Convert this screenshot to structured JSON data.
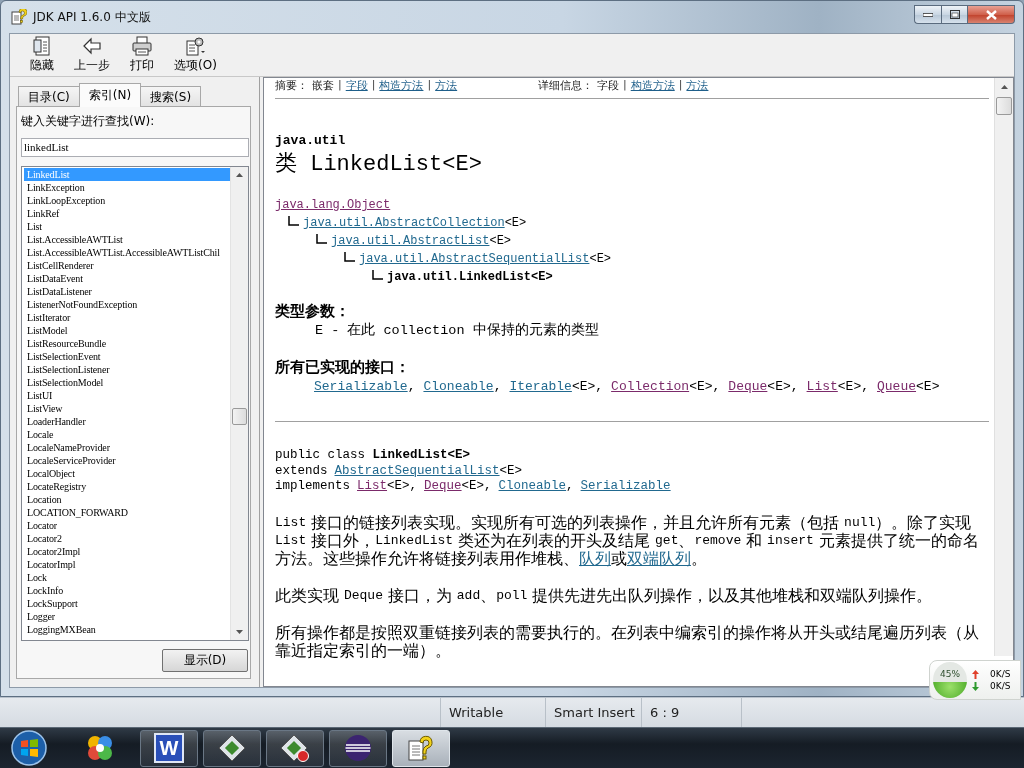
{
  "window": {
    "title": "JDK API 1.6.0 中文版"
  },
  "toolbar": [
    {
      "kind": "hide",
      "label": "隐藏"
    },
    {
      "kind": "back",
      "label": "上一步"
    },
    {
      "kind": "print",
      "label": "打印"
    },
    {
      "kind": "options",
      "label": "选项(O)"
    }
  ],
  "nav_panel": {
    "tabs": [
      {
        "label": "目录(C)",
        "selected": false
      },
      {
        "label": "索引(N)",
        "selected": true
      },
      {
        "label": "搜索(S)",
        "selected": false
      }
    ],
    "search_label": "键入关键字进行查找(W):",
    "search": {
      "value": "linkedList"
    },
    "results": [
      {
        "label": "LinkedList",
        "selected": true
      },
      {
        "label": "LinkException",
        "selected": false
      },
      {
        "label": "LinkLoopException",
        "selected": false
      },
      {
        "label": "LinkRef",
        "selected": false
      },
      {
        "label": "List",
        "selected": false
      },
      {
        "label": "List.AccessibleAWTList",
        "selected": false
      },
      {
        "label": "List.AccessibleAWTList.AccessibleAWTListChil",
        "selected": false
      },
      {
        "label": "ListCellRenderer",
        "selected": false
      },
      {
        "label": "ListDataEvent",
        "selected": false
      },
      {
        "label": "ListDataListener",
        "selected": false
      },
      {
        "label": "ListenerNotFoundException",
        "selected": false
      },
      {
        "label": "ListIterator",
        "selected": false
      },
      {
        "label": "ListModel",
        "selected": false
      },
      {
        "label": "ListResourceBundle",
        "selected": false
      },
      {
        "label": "ListSelectionEvent",
        "selected": false
      },
      {
        "label": "ListSelectionListener",
        "selected": false
      },
      {
        "label": "ListSelectionModel",
        "selected": false
      },
      {
        "label": "ListUI",
        "selected": false
      },
      {
        "label": "ListView",
        "selected": false
      },
      {
        "label": "LoaderHandler",
        "selected": false
      },
      {
        "label": "Locale",
        "selected": false
      },
      {
        "label": "LocaleNameProvider",
        "selected": false
      },
      {
        "label": "LocaleServiceProvider",
        "selected": false
      },
      {
        "label": "LocalObject",
        "selected": false
      },
      {
        "label": "LocateRegistry",
        "selected": false
      },
      {
        "label": "Location",
        "selected": false
      },
      {
        "label": "LOCATION_FORWARD",
        "selected": false
      },
      {
        "label": "Locator",
        "selected": false
      },
      {
        "label": "Locator2",
        "selected": false
      },
      {
        "label": "Locator2Impl",
        "selected": false
      },
      {
        "label": "LocatorImpl",
        "selected": false
      },
      {
        "label": "Lock",
        "selected": false
      },
      {
        "label": "LockInfo",
        "selected": false
      },
      {
        "label": "LockSupport",
        "selected": false
      },
      {
        "label": "Logger",
        "selected": false
      },
      {
        "label": "LoggingMXBean",
        "selected": false
      }
    ],
    "show_button": "显示(D)"
  },
  "document": {
    "summary_nav": {
      "label": "摘要：",
      "separator": "|",
      "items": [
        {
          "text": "嵌套",
          "link": false
        },
        {
          "text": "字段",
          "link": true
        },
        {
          "text": "构造方法",
          "link": true
        },
        {
          "text": "方法",
          "link": true
        }
      ]
    },
    "detail_nav": {
      "label": "详细信息：",
      "separator": "|",
      "items": [
        {
          "text": "字段",
          "link": false
        },
        {
          "text": "构造方法",
          "link": true
        },
        {
          "text": "方法",
          "link": true
        }
      ]
    },
    "package": "java.util",
    "class_title": "类 LinkedList<E>",
    "hierarchy": [
      {
        "kind": "link",
        "text": "java.lang.Object",
        "visited": true,
        "children": [
          {
            "kind": "link",
            "text": "java.util.AbstractCollection",
            "suffix": "<E>",
            "visited": false,
            "children": [
              {
                "kind": "link",
                "text": "java.util.AbstractList",
                "suffix": "<E>",
                "visited": false,
                "children": [
                  {
                    "kind": "link",
                    "text": "java.util.AbstractSequentialList",
                    "suffix": "<E>",
                    "visited": false,
                    "children": [
                      {
                        "kind": "current",
                        "text": "java.util.LinkedList<E>"
                      }
                    ]
                  }
                ]
              }
            ]
          }
        ]
      }
    ],
    "type_parameters": {
      "heading": "类型参数：",
      "items": [
        "E - 在此 collection 中保持的元素的类型"
      ]
    },
    "interfaces": {
      "heading": "所有已实现的接口：",
      "items": [
        {
          "text": "Serializable",
          "suffix": ",",
          "visited": false
        },
        {
          "text": "Cloneable",
          "suffix": ",",
          "visited": false
        },
        {
          "text": "Iterable",
          "suffix": "<E>,",
          "visited": false
        },
        {
          "text": "Collection",
          "suffix": "<E>,",
          "visited": true
        },
        {
          "text": "Deque",
          "suffix": "<E>,",
          "visited": true
        },
        {
          "text": "List",
          "suffix": "<E>,",
          "visited": true
        },
        {
          "text": "Queue",
          "suffix": "<E>",
          "visited": true
        }
      ]
    },
    "declaration": {
      "signature": "public class **LinkedList<E>**",
      "clauses": [
        {
          "keyword": "extends",
          "links": [
            {
              "text": "AbstractSequentialList",
              "suffix": "<E>",
              "visited": false
            }
          ]
        },
        {
          "keyword": "implements",
          "links": [
            {
              "text": "List",
              "suffix": "<E>,",
              "visited": true
            },
            {
              "text": "Deque",
              "suffix": "<E>,",
              "visited": true
            },
            {
              "text": "Cloneable",
              "suffix": ",",
              "visited": false
            },
            {
              "text": "Serializable",
              "visited": false
            }
          ]
        }
      ]
    },
    "description": [
      {
        "segments": [
          {
            "kind": "code",
            "text": "List"
          },
          {
            "kind": "text",
            "text": " 接口的链接列表实现。实现所有可选的列表操作，并且允许所有元素（包括 "
          },
          {
            "kind": "code",
            "text": "null"
          },
          {
            "kind": "text",
            "text": "）。除了实现 "
          },
          {
            "kind": "code",
            "text": "List"
          },
          {
            "kind": "text",
            "text": " 接口外，"
          },
          {
            "kind": "code",
            "text": "LinkedList"
          },
          {
            "kind": "text",
            "text": " 类还为在列表的开头及结尾 "
          },
          {
            "kind": "code",
            "text": "get"
          },
          {
            "kind": "text",
            "text": "、"
          },
          {
            "kind": "code",
            "text": "remove"
          },
          {
            "kind": "text",
            "text": " 和 "
          },
          {
            "kind": "code",
            "text": "insert"
          },
          {
            "kind": "text",
            "text": " 元素提供了统一的命名方法。这些操作允许将链接列表用作堆栈、"
          },
          {
            "kind": "link",
            "text": "队列"
          },
          {
            "kind": "text",
            "text": "或"
          },
          {
            "kind": "link",
            "text": "双端队列"
          },
          {
            "kind": "text",
            "text": "。"
          }
        ]
      },
      {
        "segments": [
          {
            "kind": "text",
            "text": "此类实现 "
          },
          {
            "kind": "code",
            "text": "Deque"
          },
          {
            "kind": "text",
            "text": " 接口，为 "
          },
          {
            "kind": "code",
            "text": "add"
          },
          {
            "kind": "text",
            "text": "、"
          },
          {
            "kind": "code",
            "text": "poll"
          },
          {
            "kind": "text",
            "text": " 提供先进先出队列操作，以及其他堆栈和双端队列操作。"
          }
        ]
      },
      {
        "segments": [
          {
            "kind": "text",
            "text": "所有操作都是按照双重链接列表的需要执行的。在列表中编索引的操作将从开头或结尾遍历列表（从靠近指定索引的一端）。"
          }
        ]
      }
    ]
  },
  "network_monitor": {
    "memory": {
      "level": 0.45,
      "reading": "45%"
    },
    "upload": "0K/S",
    "download": "0K/S"
  },
  "status_bar": [
    "Writable",
    "Smart Insert",
    "6 : 9"
  ],
  "taskbar": [
    {
      "kind": "pinwheel",
      "running": false,
      "active": false
    },
    {
      "kind": "writer",
      "label": "W",
      "running": true,
      "active": false
    },
    {
      "kind": "diamond",
      "running": true,
      "active": false
    },
    {
      "kind": "diamond-badge",
      "running": true,
      "active": false
    },
    {
      "kind": "eclipse",
      "running": true,
      "active": false
    },
    {
      "kind": "help",
      "running": true,
      "active": true
    }
  ]
}
